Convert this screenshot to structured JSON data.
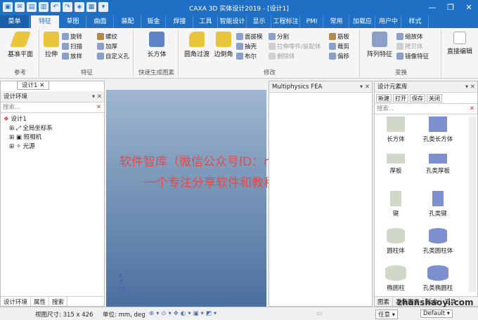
{
  "titlebar": {
    "title": "CAXA 3D 实体设计2019 - [设计1]",
    "qa": [
      "▣",
      "✉",
      "▤",
      "▥",
      "↶",
      "↷",
      "◈",
      "▦",
      "▾"
    ],
    "wb": [
      "—",
      "❐",
      "✕"
    ]
  },
  "tabs": [
    "菜单",
    "特征",
    "草图",
    "曲面",
    "装配",
    "钣金",
    "焊接",
    "工具",
    "智能设计",
    "显示",
    "工程标注",
    "PMI",
    "常用",
    "加载应用",
    "用户中心",
    "样式"
  ],
  "ribbon": {
    "ref": {
      "big": "基准平面",
      "label": "参考"
    },
    "feat": {
      "big": "拉伸",
      "small": [
        "旋转",
        "扫描",
        "放样",
        "螺纹",
        "加厚",
        "自定义孔"
      ],
      "label": "特征"
    },
    "quick": {
      "big": "长方体",
      "label": "快速生成图素"
    },
    "mod": {
      "big1": "圆角过渡",
      "big2": "边倒角",
      "small": [
        "面拔模",
        "抽壳",
        "布尔",
        "分割",
        "拉伸零件/装配体",
        "删除体",
        "筋板",
        "裁剪",
        "偏移"
      ],
      "label": "修改"
    },
    "trans": {
      "big": "阵列特征",
      "small": [
        "缩放体",
        "拷贝体",
        "镜像特征"
      ],
      "label": "变换"
    },
    "edit": {
      "big": "直接编辑"
    }
  },
  "doc_tab": "设计1",
  "left": {
    "title": "设计环境",
    "search": "搜索...",
    "tree": [
      "设计1",
      "全局坐标系",
      "照相机",
      "光源"
    ]
  },
  "fea": {
    "title": "Multiphysics FEA"
  },
  "lib": {
    "title": "设计元素库",
    "toolbar": [
      "新建",
      "打开",
      "保存",
      "关闭"
    ],
    "search": "搜索...",
    "items": [
      "长方体",
      "孔类长方体",
      "厚板",
      "孔类厚板",
      "键",
      "孔类键",
      "圆柱体",
      "孔类圆柱体",
      "椭圆柱",
      "孔类椭圆柱"
    ],
    "btabs": [
      "图素",
      "高级图素",
      "钣金",
      "工具"
    ]
  },
  "watermark": [
    "软件智库（微信公众号ID：rjzkgzh）",
    "一个专注分享软件和教程的公众号！"
  ],
  "bottom_left": [
    "设计环境",
    "属性",
    "搜索"
  ],
  "status": {
    "size": "视图尺寸: 315 x 426",
    "unit": "单位: mm, deg",
    "any": "任意",
    "default": "Default",
    "url": "zhanshaoyi.com"
  },
  "colors": {
    "titlebar": "#1f6fc5",
    "watermark": "#e24a4a"
  }
}
